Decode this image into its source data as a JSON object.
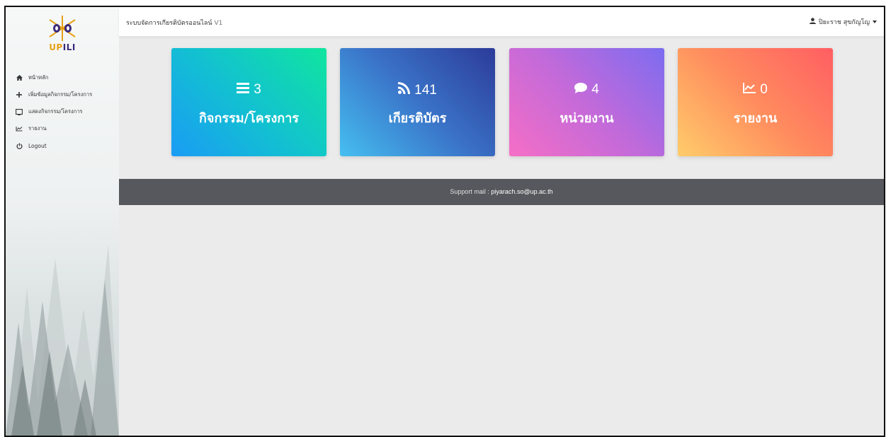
{
  "header": {
    "app_title": "ระบบจัดการเกียรติบัตรออนไลน์",
    "version": "V1",
    "user_name": "ปิยะราช สุขกัญโญ"
  },
  "logo": {
    "text_up": "UP",
    "text_ili": "ILI"
  },
  "sidebar": {
    "items": [
      {
        "label": "หน้าหลัก",
        "icon": "home-icon"
      },
      {
        "label": "เพิ่มข้อมูลกิจกรรม/โครงการ",
        "icon": "plus-icon"
      },
      {
        "label": "แสดงกิจกรรม/โครงการ",
        "icon": "window-icon"
      },
      {
        "label": "รายงาน",
        "icon": "chart-icon"
      },
      {
        "label": "Logout",
        "icon": "power-icon"
      }
    ]
  },
  "cards": [
    {
      "count": "3",
      "label": "กิจกรรม/โครงการ",
      "icon": "list-icon"
    },
    {
      "count": "141",
      "label": "เกียรติบัตร",
      "icon": "rss-icon"
    },
    {
      "count": "4",
      "label": "หน่วยงาน",
      "icon": "comment-icon"
    },
    {
      "count": "0",
      "label": "รายงาน",
      "icon": "area-chart-icon"
    }
  ],
  "footer": {
    "prefix": "Support mail :",
    "email": "piyarach.so@up.ac.th"
  },
  "colors": {
    "footer_bg": "#57585d",
    "content_bg": "#ebebeb",
    "card1": "#12c2cf",
    "card2": "#3a73c8",
    "card3": "#c26ada",
    "card4": "#ff8c5e"
  }
}
